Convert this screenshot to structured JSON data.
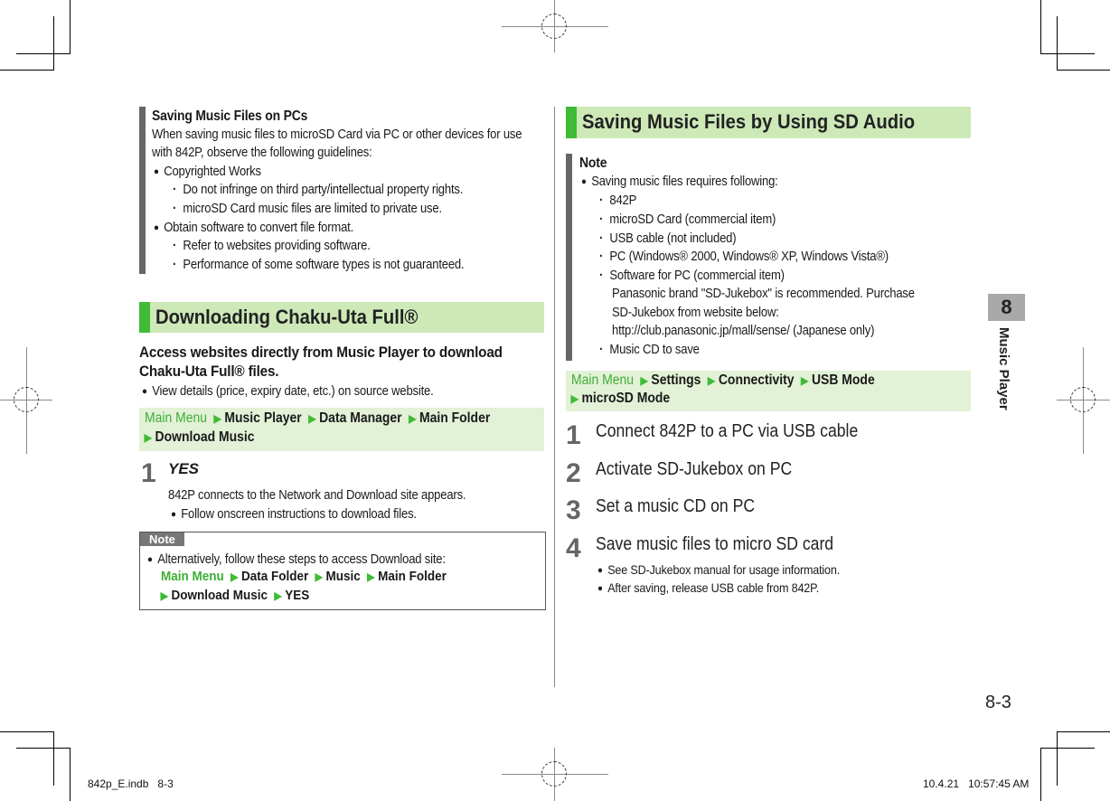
{
  "left": {
    "pcs_box": {
      "title": "Saving Music Files on PCs",
      "intro_1": "When saving music files to microSD Card via PC or other devices for use",
      "intro_2": "with 842P, observe the following guidelines:",
      "items": [
        {
          "label": "Copyrighted Works",
          "sub": [
            "Do not infringe on third party/intellectual property rights.",
            "microSD Card music files are limited to private use."
          ]
        },
        {
          "label": "Obtain software to convert file format.",
          "sub": [
            "Refer to websites providing software.",
            "Performance of some software types is not guaranteed."
          ]
        }
      ]
    },
    "section_title": "Downloading Chaku-Uta Full®",
    "lead_1": "Access websites directly from Music Player to download",
    "lead_2": "Chaku-Uta Full® files.",
    "lead_bullet": "View details (price, expiry date, etc.) on source website.",
    "nav": {
      "start": "Main Menu",
      "steps": [
        "Music Player",
        "Data Manager",
        "Main Folder",
        "Download Music"
      ]
    },
    "step": {
      "number": "1",
      "label": "YES",
      "desc": "842P connects to the Network and Download site appears.",
      "bullet": "Follow onscreen instructions to download files."
    },
    "note": {
      "tag": "Note",
      "bullet": "Alternatively, follow these steps to access Download site:",
      "nav_start": "Main Menu",
      "nav_steps": [
        "Data Folder",
        "Music",
        "Main Folder",
        "Download Music",
        "YES"
      ]
    }
  },
  "right": {
    "section_title": "Saving Music Files by Using SD Audio",
    "note": {
      "title": "Note",
      "bullet": "Saving music files requires following:",
      "items": [
        "842P",
        "microSD Card (commercial item)",
        "USB cable (not included)",
        "PC (Windows® 2000, Windows® XP, Windows Vista®)",
        "Software for PC (commercial item)"
      ],
      "software_lines": [
        "Panasonic brand \"SD-Jukebox\" is recommended. Purchase",
        "SD-Jukebox from website below:",
        "http://club.panasonic.jp/mall/sense/ (Japanese only)"
      ],
      "last_item": "Music CD to save"
    },
    "nav": {
      "start": "Main Menu",
      "steps": [
        "Settings",
        "Connectivity",
        "USB Mode",
        "microSD Mode"
      ]
    },
    "steps": [
      {
        "number": "1",
        "text": "Connect 842P to a PC via USB cable"
      },
      {
        "number": "2",
        "text": "Activate SD-Jukebox on PC"
      },
      {
        "number": "3",
        "text": "Set a music CD on PC"
      },
      {
        "number": "4",
        "text": "Save music files to micro SD card"
      }
    ],
    "step4_bullets": [
      "See SD-Jukebox manual for usage information.",
      "After saving, release USB cable from 842P."
    ]
  },
  "chapter": {
    "number": "8",
    "label": "Music Player"
  },
  "page_number": "8-3",
  "slug": {
    "file": "842p_E.indb   8-3",
    "timestamp": "10.4.21   10:57:45 AM"
  },
  "colors": {
    "accent_green": "#3fbb35",
    "header_bg": "#cde9b8",
    "nav_bg": "#e3f1d7",
    "bar_gray": "#666666"
  }
}
